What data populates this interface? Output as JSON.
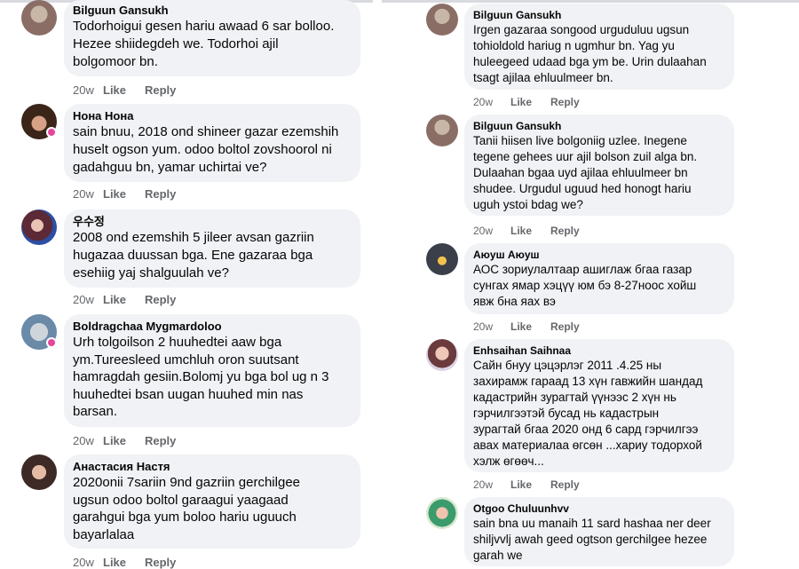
{
  "colors": {
    "bubble": "#f0f2f5",
    "meta": "#65676b",
    "text": "#050505"
  },
  "comments_left": [
    {
      "author": "Bilguun Gansukh",
      "text": "Todorhoigui gesen hariu awaad 6 sar bolloo.\nHezee shiidegdeh we. Todorhoi ajil\nbolgomoor bn.",
      "time": "20w",
      "like": "Like",
      "reply": "Reply"
    },
    {
      "author": "Нона Нона",
      "text": "sain bnuu, 2018 ond shineer gazar ezemshih\nhuselt ogson yum. odoo boltol zovshoorol ni\ngadahguu bn, yamar uchirtai ve?",
      "time": "20w",
      "like": "Like",
      "reply": "Reply"
    },
    {
      "author": "우수정",
      "text": "2008 ond ezemshih 5 jileer avsan gazriin\nhugazaa duussan bga. Ene gazaraa bga\nesehiig yaj shalguulah ve?",
      "time": "20w",
      "like": "Like",
      "reply": "Reply"
    },
    {
      "author": "Boldragchaa Mygmardoloo",
      "text": "Urh tolgoilson 2 huuhedtei aaw bga\nym.Tureesleed umchluh oron suutsant\nhamragdah gesiin.Bolomj yu bga bol ug n 3\nhuuhedtei bsan uugan huuhed min nas\nbarsan.",
      "time": "20w",
      "like": "Like",
      "reply": "Reply"
    },
    {
      "author": "Анастасия Настя",
      "text": "2020onii 7sariin 9nd gazriin gerchilgee\nugsun odoo boltol garaagui yaagaad\ngarahgui bga yum boloo hariu uguuch\nbayarlalaa",
      "time": "20w",
      "like": "Like",
      "reply": "Reply"
    }
  ],
  "comments_right": [
    {
      "author": "Bilguun Gansukh",
      "text": "Irgen gazaraa songood urguduluu ugsun\ntohioldold hariug n ugmhur bn. Yag yu\nhuleegeed udaad bga ym be. Urin dulaahan\ntsagt ajilaa ehluulmeer bn.",
      "time": "20w",
      "like": "Like",
      "reply": "Reply"
    },
    {
      "author": "Bilguun Gansukh",
      "text": "Tanii hiisen live bolgoniig uzlee. Inegene\ntegene gehees uur ajil bolson zuil alga bn.\nDulaahan bgaa uyd ajilaa ehluulmeer bn\nshudee.  Urgudul uguud hed honogt hariu\nuguh ystoi bdag we?",
      "time": "20w",
      "like": "Like",
      "reply": "Reply"
    },
    {
      "author": "Аюуш Аюуш",
      "text": "АОС зориулалтаар ашиглаж бгаа газар\nсунгах ямар хэцүү юм бэ 8-27ноос хойш\nявж бна яах вэ",
      "time": "20w",
      "like": "Like",
      "reply": "Reply"
    },
    {
      "author": "Enhsaihan Saihnaa",
      "text": "Сайн бнуу цэцэрлэг 2011 .4.25 ны\nзахирамж гараад 13 хүн гавжийн шандад\nкадастрийн зурагтай үүнээс 2 хүн нь\nгэрчилгээтэй бусад нь кадастрын\nзурагтай бгаа 2020 онд 6 сард  гэрчилгээ\nавах  материалаа өгсөн ...хариу тодорхой\nхэлж өгөөч...",
      "time": "20w",
      "like": "Like",
      "reply": "Reply"
    },
    {
      "author": "Otgoo Chuluunhvv",
      "text": "sain bna uu manaih 11 sard hashaa ner deer\nshiljvvlj awah geed ogtson gerchilgee hezee\ngarah we",
      "time": "",
      "like": "",
      "reply": ""
    }
  ]
}
